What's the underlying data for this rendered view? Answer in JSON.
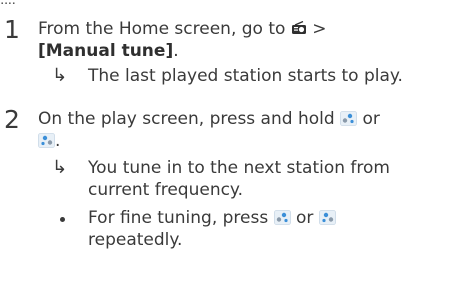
{
  "steps": [
    {
      "number": "1",
      "text_prefix": "From the Home screen, go to",
      "text_suffix": ">",
      "bracket_label": "[Manual tune]",
      "bracket_trailing": ".",
      "result": "The last played station starts to play."
    },
    {
      "number": "2",
      "line1_prefix": "On the play screen, press and hold",
      "line1_suffix": "or",
      "line2_trailing": ".",
      "result_line1": "You tune in to the next station from",
      "result_line2": "current frequency.",
      "bullet_line1_prefix": "For fine tuning, press",
      "bullet_line1_mid": "or",
      "bullet_line2": "repeatedly."
    }
  ],
  "arrow_glyph": "↳",
  "icons": {
    "radio": "radio-icon",
    "prev_button": "previous-button-icon",
    "next_button": "next-button-icon"
  },
  "colors": {
    "text": "#3a3a3a",
    "icon_blue": "#3b8fd8",
    "icon_bg": "#e8f0f7"
  }
}
